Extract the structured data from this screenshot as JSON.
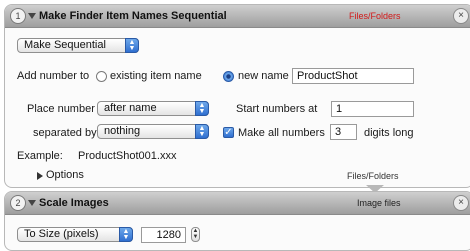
{
  "action1": {
    "step_number": "1",
    "title": "Make Finder Item Names Sequential",
    "category": "Files/Folders",
    "category_color": "#d21a1a",
    "mode_popup": "Make Sequential",
    "add_number_to_label": "Add number to",
    "existing_item_name_label": "existing item name",
    "new_name_label": "new name",
    "new_name_value": "ProductShot",
    "place_number_label": "Place number",
    "place_number_value": "after name",
    "start_numbers_label": "Start numbers at",
    "start_numbers_value": "1",
    "separated_by_label": "separated by",
    "separated_by_value": "nothing",
    "make_all_numbers_label": "Make all numbers",
    "digits_value": "3",
    "digits_long_label": "digits long",
    "example_label": "Example:",
    "example_value": "ProductShot001.xxx",
    "options_label": "Options",
    "footer_category": "Files/Folders"
  },
  "action2": {
    "step_number": "2",
    "title": "Scale Images",
    "category": "Image files",
    "category_color": "#222222",
    "scale_mode_popup": "To Size (pixels)",
    "size_value": "1280"
  }
}
